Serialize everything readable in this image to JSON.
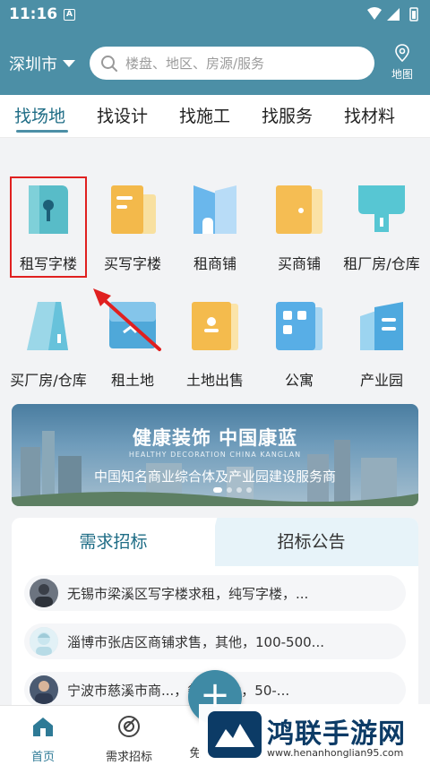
{
  "status_bar": {
    "time": "11:16",
    "notification": "A"
  },
  "header": {
    "city": "深圳市",
    "search_placeholder": "楼盘、地区、房源/服务",
    "map_label": "地图"
  },
  "tabs": [
    "找场地",
    "找设计",
    "找施工",
    "找服务",
    "找材料"
  ],
  "categories": [
    {
      "label": "租写字楼",
      "icon": "office-rent-icon"
    },
    {
      "label": "买写字楼",
      "icon": "office-buy-icon"
    },
    {
      "label": "租商铺",
      "icon": "shop-rent-icon"
    },
    {
      "label": "买商铺",
      "icon": "shop-buy-icon"
    },
    {
      "label": "租厂房/仓库",
      "icon": "factory-rent-icon"
    },
    {
      "label": "买厂房/仓库",
      "icon": "factory-buy-icon"
    },
    {
      "label": "租土地",
      "icon": "land-rent-icon"
    },
    {
      "label": "土地出售",
      "icon": "land-sale-icon"
    },
    {
      "label": "公寓",
      "icon": "apartment-icon"
    },
    {
      "label": "产业园",
      "icon": "industrial-park-icon"
    }
  ],
  "banner": {
    "title": "健康装饰 中国康蓝",
    "subtitle_en": "HEALTHY DECORATION CHINA KANGLAN",
    "subtitle": "中国知名商业综合体及产业园建设服务商"
  },
  "panel": {
    "tab_active": "需求招标",
    "tab_other": "招标公告",
    "items": [
      "无锡市梁溪区写字楼求租，纯写字楼，...",
      "淄博市张店区商铺求售，其他，100-500...",
      "宁波市慈溪市商...，餐饮美食，50-..."
    ]
  },
  "bottom_nav": [
    {
      "label": "首页",
      "icon": "home-icon"
    },
    {
      "label": "需求招标",
      "icon": "target-icon"
    },
    {
      "label": "免",
      "icon": "free-icon"
    }
  ],
  "fab_label": "+",
  "watermark": {
    "cn": "鸿联手游网",
    "en": "www.henanhonglian95.com"
  },
  "colors": {
    "brand": "#4c8fa6",
    "accent_text": "#1f6d86",
    "highlight": "#e02020"
  }
}
